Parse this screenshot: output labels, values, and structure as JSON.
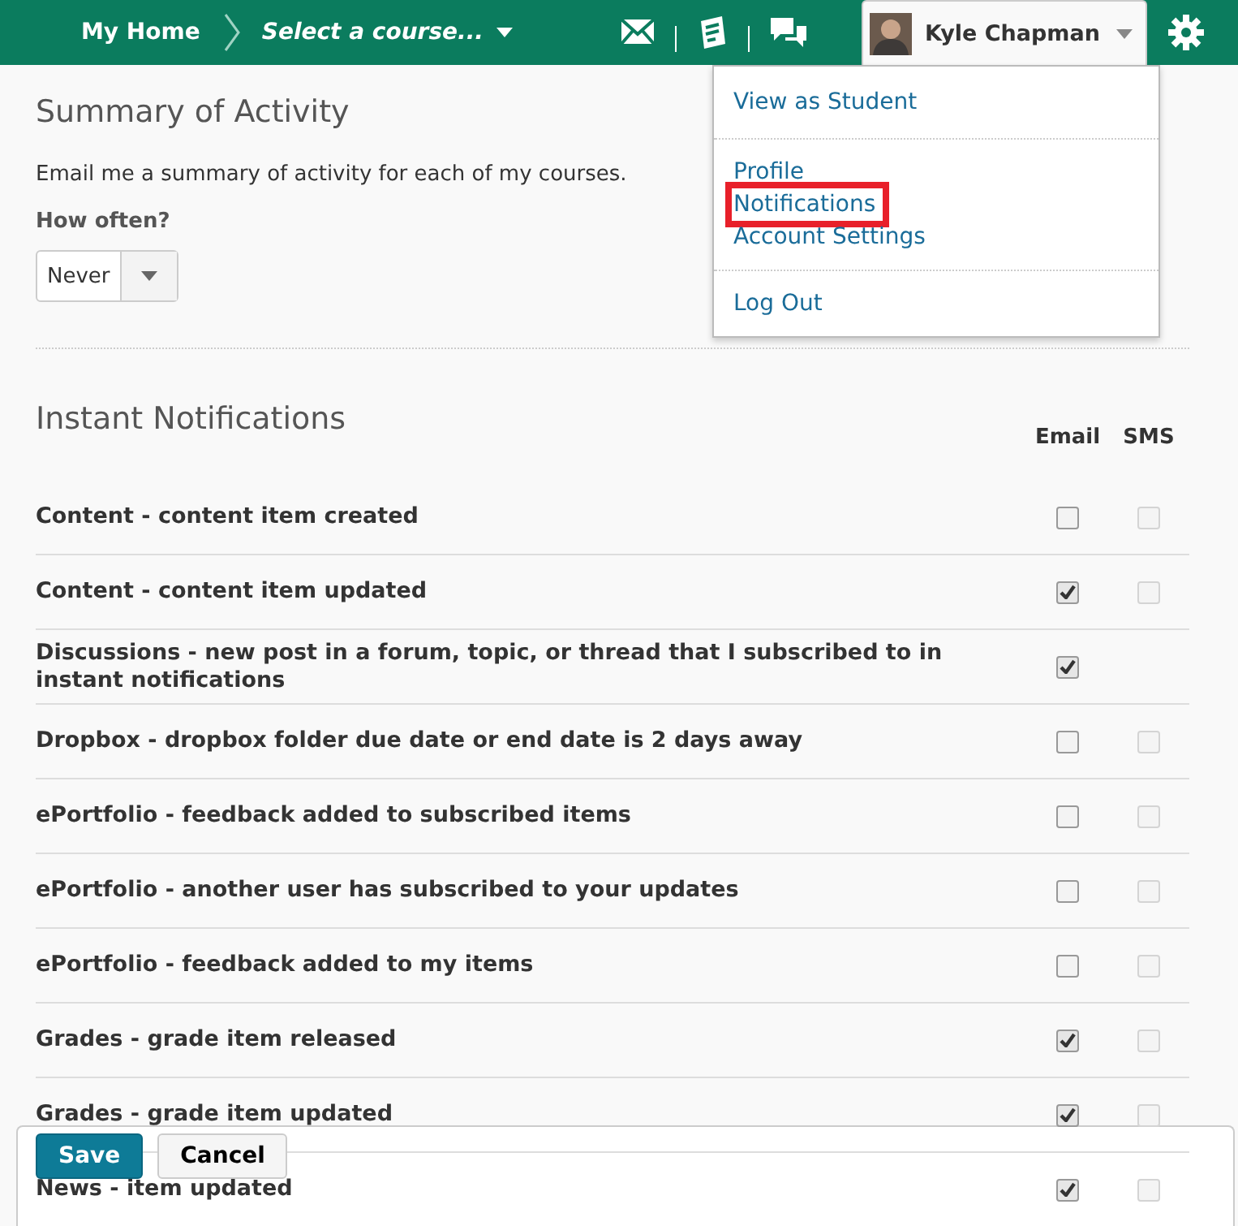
{
  "navbar": {
    "home": "My Home",
    "course_selector": "Select a course...",
    "user_name": "Kyle Chapman",
    "user_menu_expanded": true
  },
  "user_menu": [
    {
      "items": [
        {
          "label": "View as Student",
          "highlighted": false
        }
      ]
    },
    {
      "items": [
        {
          "label": "Profile",
          "highlighted": false
        },
        {
          "label": "Notifications",
          "highlighted": true
        },
        {
          "label": "Account Settings",
          "highlighted": false
        }
      ]
    },
    {
      "items": [
        {
          "label": "Log Out",
          "highlighted": false
        }
      ]
    }
  ],
  "summary": {
    "title": "Summary of Activity",
    "description": "Email me a summary of activity for each of my courses.",
    "frequency_label": "How often?",
    "frequency_value": "Never"
  },
  "instant": {
    "title": "Instant Notifications",
    "columns": [
      "Email",
      "SMS"
    ],
    "rows": [
      {
        "label": "Content - content item created",
        "email_checked": false,
        "sms": {
          "checked": false,
          "disabled": true
        }
      },
      {
        "label": "Content - content item updated",
        "email_checked": true,
        "sms": {
          "checked": false,
          "disabled": true
        }
      },
      {
        "label": "Discussions - new post in a forum, topic, or thread that I subscribed to in instant notifications",
        "email_checked": true
      },
      {
        "label": "Dropbox - dropbox folder due date or end date is 2 days away",
        "email_checked": false,
        "sms": {
          "checked": false,
          "disabled": true
        }
      },
      {
        "label": "ePortfolio - feedback added to subscribed items",
        "email_checked": false,
        "sms": {
          "checked": false,
          "disabled": true
        }
      },
      {
        "label": "ePortfolio - another user has subscribed to your updates",
        "email_checked": false,
        "sms": {
          "checked": false,
          "disabled": true
        }
      },
      {
        "label": "ePortfolio - feedback added to my items",
        "email_checked": false,
        "sms": {
          "checked": false,
          "disabled": true
        }
      },
      {
        "label": "Grades - grade item released",
        "email_checked": true,
        "sms": {
          "checked": false,
          "disabled": true
        }
      },
      {
        "label": "Grades - grade item updated",
        "email_checked": true,
        "sms": {
          "checked": false,
          "disabled": true
        }
      },
      {
        "label": "News - item updated",
        "email_checked": true,
        "sms": {
          "checked": false,
          "disabled": true
        }
      }
    ]
  },
  "actions": [
    {
      "label": "Save",
      "kind": "primary"
    },
    {
      "label": "Cancel",
      "kind": "secondary"
    }
  ]
}
